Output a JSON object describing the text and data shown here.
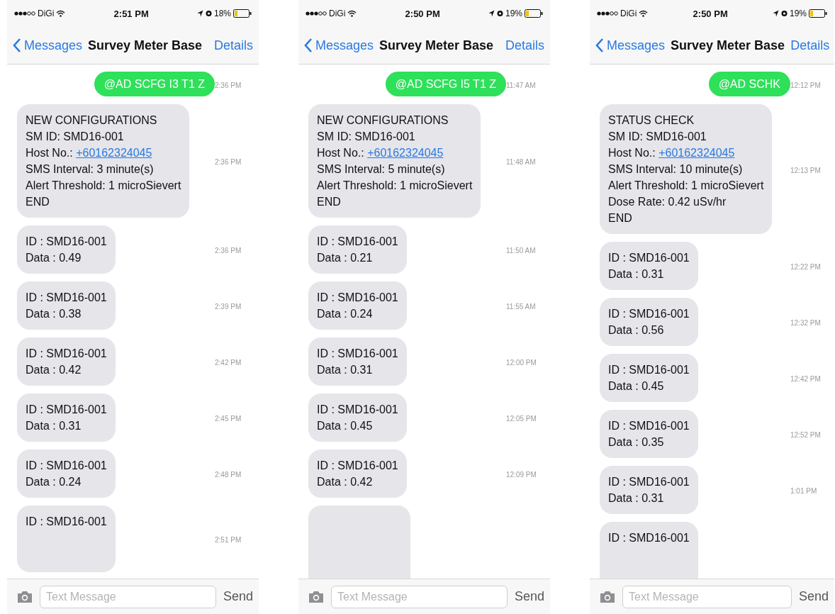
{
  "phones": [
    {
      "status": {
        "carrier": "DiGi",
        "time": "2:51 PM",
        "battery": "18%"
      },
      "nav": {
        "back": "Messages",
        "title": "Survey Meter Base",
        "action": "Details"
      },
      "messages": [
        {
          "kind": "sent",
          "lines": [
            {
              "text": "@AD SCFG I3 T1 Z"
            }
          ],
          "time": "2:36 PM"
        },
        {
          "kind": "received",
          "lines": [
            {
              "text": "NEW CONFIGURATIONS"
            },
            {
              "text": "SM ID: SMD16-001"
            },
            {
              "text": "Host No.: ",
              "link": "+60162324045"
            },
            {
              "text": "SMS Interval: 3 minute(s)"
            },
            {
              "text": "Alert Threshold: 1 microSievert"
            },
            {
              "text": "END"
            }
          ],
          "time": "2:36 PM"
        },
        {
          "kind": "received",
          "lines": [
            {
              "text": "ID : SMD16-001"
            },
            {
              "text": "Data : 0.49"
            }
          ],
          "time": "2:36 PM"
        },
        {
          "kind": "received",
          "lines": [
            {
              "text": "ID : SMD16-001"
            },
            {
              "text": "Data : 0.38"
            }
          ],
          "time": "2:39 PM"
        },
        {
          "kind": "received",
          "lines": [
            {
              "text": "ID : SMD16-001"
            },
            {
              "text": "Data : 0.42"
            }
          ],
          "time": "2:42 PM"
        },
        {
          "kind": "received",
          "lines": [
            {
              "text": "ID : SMD16-001"
            },
            {
              "text": "Data : 0.31"
            }
          ],
          "time": "2:45 PM"
        },
        {
          "kind": "received",
          "lines": [
            {
              "text": "ID : SMD16-001"
            },
            {
              "text": "Data : 0.24"
            }
          ],
          "time": "2:48 PM"
        },
        {
          "kind": "received",
          "lines": [
            {
              "text": "ID : SMD16-001"
            }
          ],
          "time": "2:51 PM"
        }
      ],
      "input": {
        "placeholder": "Text Message",
        "send": "Send"
      }
    },
    {
      "status": {
        "carrier": "DiGi",
        "time": "2:50 PM",
        "battery": "19%"
      },
      "nav": {
        "back": "Messages",
        "title": "Survey Meter Base",
        "action": "Details"
      },
      "messages": [
        {
          "kind": "sent",
          "lines": [
            {
              "text": "@AD SCFG I5 T1 Z"
            }
          ],
          "time": "11:47 AM"
        },
        {
          "kind": "received",
          "lines": [
            {
              "text": "NEW CONFIGURATIONS"
            },
            {
              "text": "SM ID: SMD16-001"
            },
            {
              "text": "Host No.: ",
              "link": "+60162324045"
            },
            {
              "text": "SMS Interval: 5 minute(s)"
            },
            {
              "text": "Alert Threshold: 1 microSievert"
            },
            {
              "text": "END"
            }
          ],
          "time": "11:48 AM"
        },
        {
          "kind": "received",
          "lines": [
            {
              "text": "ID : SMD16-001"
            },
            {
              "text": "Data : 0.21"
            }
          ],
          "time": "11:50 AM"
        },
        {
          "kind": "received",
          "lines": [
            {
              "text": "ID : SMD16-001"
            },
            {
              "text": "Data : 0.24"
            }
          ],
          "time": "11:55 AM"
        },
        {
          "kind": "received",
          "lines": [
            {
              "text": "ID : SMD16-001"
            },
            {
              "text": "Data : 0.31"
            }
          ],
          "time": "12:00 PM"
        },
        {
          "kind": "received",
          "lines": [
            {
              "text": "ID : SMD16-001"
            },
            {
              "text": "Data : 0.45"
            }
          ],
          "time": "12:05 PM"
        },
        {
          "kind": "received",
          "lines": [
            {
              "text": "ID : SMD16-001"
            },
            {
              "text": "Data : 0.42"
            }
          ],
          "time": "12:09 PM"
        },
        {
          "kind": "received"
        }
      ],
      "input": {
        "placeholder": "Text Message",
        "send": "Send"
      }
    },
    {
      "status": {
        "carrier": "DiGi",
        "time": "2:50 PM",
        "battery": "19%"
      },
      "nav": {
        "back": "Messages",
        "title": "Survey Meter Base",
        "action": "Details"
      },
      "messages": [
        {
          "kind": "sent",
          "lines": [
            {
              "text": "@AD SCHK"
            }
          ],
          "time": "12:12 PM"
        },
        {
          "kind": "received",
          "lines": [
            {
              "text": "STATUS CHECK"
            },
            {
              "text": "SM ID: SMD16-001"
            },
            {
              "text": "Host No.: ",
              "link": "+60162324045"
            },
            {
              "text": "SMS Interval: 10 minute(s)"
            },
            {
              "text": "Alert Threshold: 1 microSievert"
            },
            {
              "text": "Dose Rate: 0.42 uSv/hr"
            },
            {
              "text": "END"
            }
          ],
          "time": "12:13 PM"
        },
        {
          "kind": "received",
          "lines": [
            {
              "text": "ID : SMD16-001"
            },
            {
              "text": "Data : 0.31"
            }
          ],
          "time": "12:22 PM"
        },
        {
          "kind": "received",
          "lines": [
            {
              "text": "ID : SMD16-001"
            },
            {
              "text": "Data : 0.56"
            }
          ],
          "time": "12:32 PM"
        },
        {
          "kind": "received",
          "lines": [
            {
              "text": "ID : SMD16-001"
            },
            {
              "text": "Data : 0.45"
            }
          ],
          "time": "12:42 PM"
        },
        {
          "kind": "received",
          "lines": [
            {
              "text": "ID : SMD16-001"
            },
            {
              "text": "Data : 0.35"
            }
          ],
          "time": "12:52 PM"
        },
        {
          "kind": "received",
          "lines": [
            {
              "text": "ID : SMD16-001"
            },
            {
              "text": "Data : 0.31"
            }
          ],
          "time": "1:01 PM"
        },
        {
          "kind": "received",
          "lines": [
            {
              "text": "ID : SMD16-001"
            }
          ]
        }
      ],
      "input": {
        "placeholder": "Text Message",
        "send": "Send"
      }
    }
  ]
}
